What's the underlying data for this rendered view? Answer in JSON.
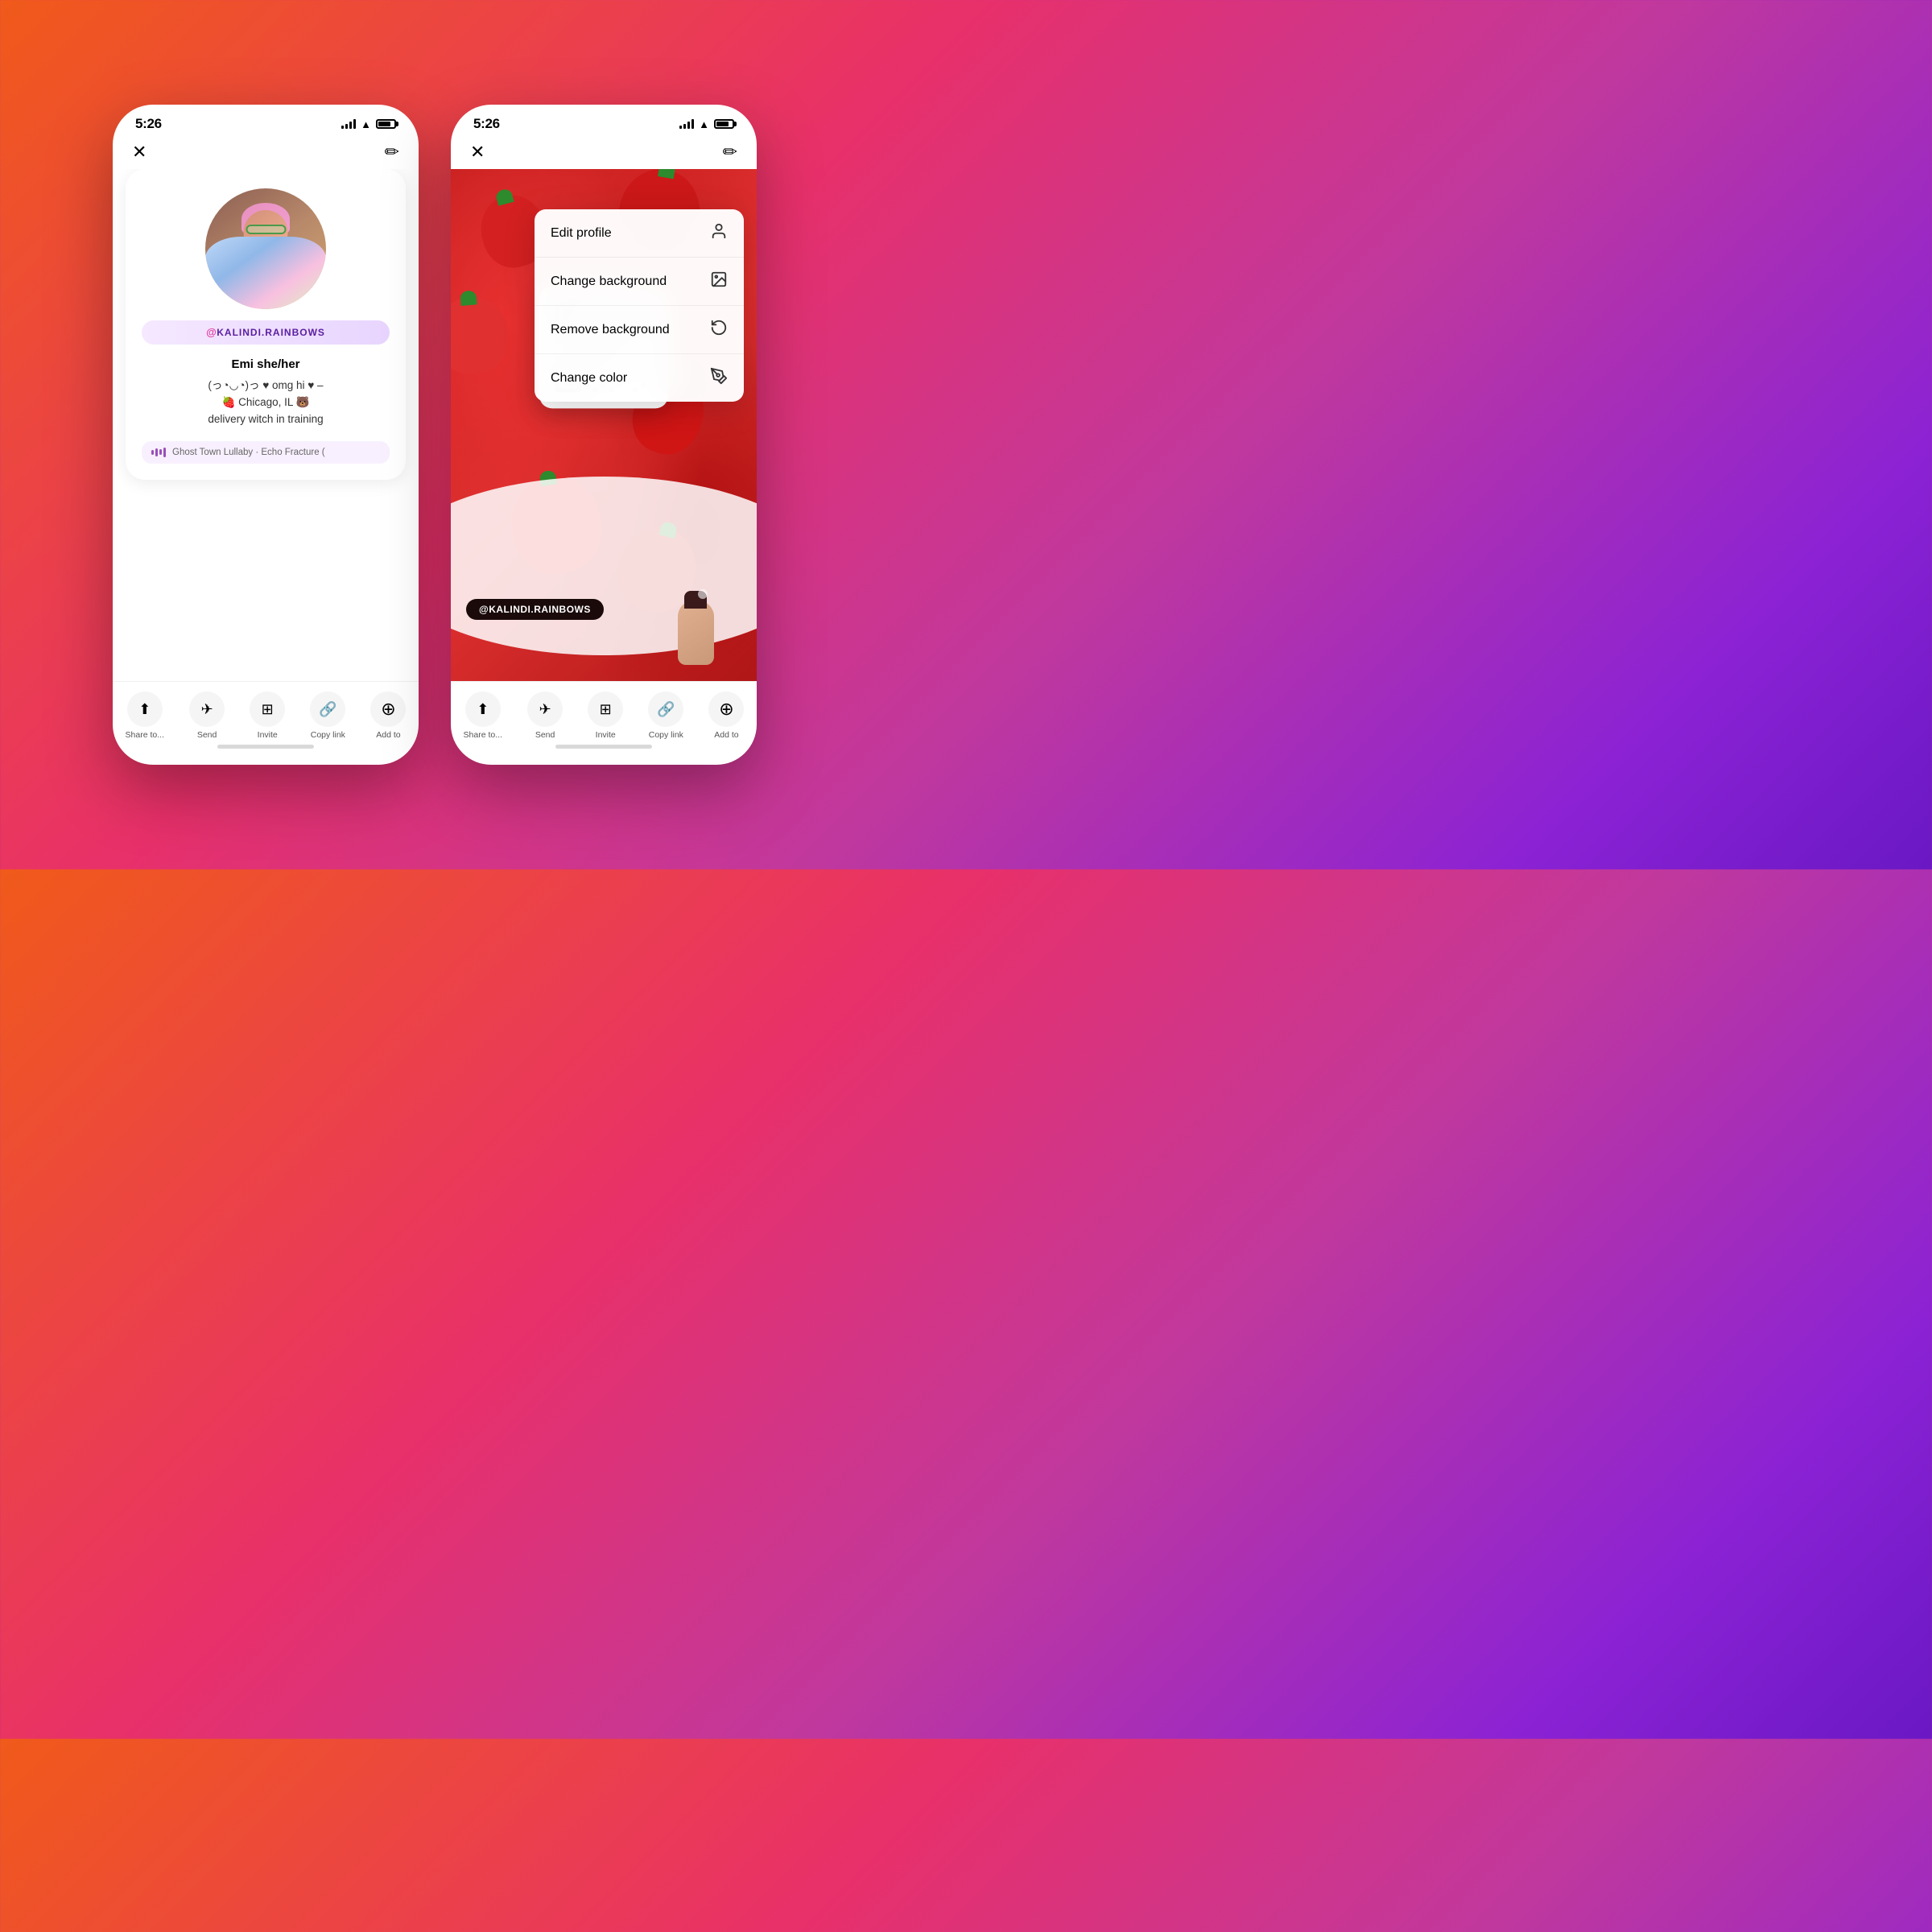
{
  "background": {
    "gradient": "linear-gradient(135deg, #f05a1a 0%, #e8306a 35%, #c0389e 60%, #8b22d4 85%, #6a18c4 100%)"
  },
  "phone1": {
    "status_bar": {
      "time": "5:26"
    },
    "nav": {
      "close_icon": "✕",
      "edit_icon": "✏"
    },
    "profile": {
      "username": "@KALINDI.RAINBOWS",
      "name": "Emi she/her",
      "bio_line1": "(っ◔◡◔)っ ♥ omg hi ♥ –",
      "bio_line2": "🍓 Chicago, IL 🐻",
      "bio_line3": "delivery witch in training"
    },
    "music": {
      "song": "Ghost Town Lullaby · Echo Fracture (",
      "icon": "🎵"
    },
    "actions": [
      {
        "label": "Share to...",
        "icon": "⬆"
      },
      {
        "label": "Send",
        "icon": "✈"
      },
      {
        "label": "Invite",
        "icon": "⊞"
      },
      {
        "label": "Copy link",
        "icon": "🔗"
      },
      {
        "label": "Add to",
        "icon": "+"
      }
    ]
  },
  "phone2": {
    "status_bar": {
      "time": "5:26"
    },
    "nav": {
      "close_icon": "✕",
      "edit_icon": "✏"
    },
    "dropdown": {
      "items": [
        {
          "label": "Edit profile",
          "icon": "👤"
        },
        {
          "label": "Change background",
          "icon": "🖼"
        },
        {
          "label": "Remove background",
          "icon": "↺"
        },
        {
          "label": "Change color",
          "icon": "✏"
        }
      ]
    },
    "username": "@KALINDI.RAINBOWS",
    "actions": [
      {
        "label": "Share to...",
        "icon": "⬆"
      },
      {
        "label": "Send",
        "icon": "✈"
      },
      {
        "label": "Invite",
        "icon": "⊞"
      },
      {
        "label": "Copy link",
        "icon": "🔗"
      },
      {
        "label": "Add to",
        "icon": "+"
      }
    ]
  }
}
